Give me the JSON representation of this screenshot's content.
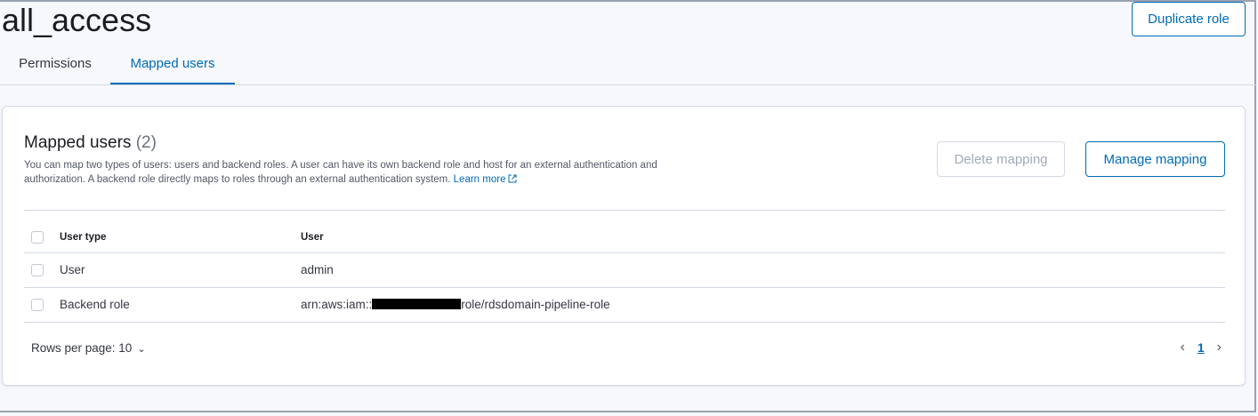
{
  "page": {
    "role_name": "all_access",
    "duplicate_label": "Duplicate role"
  },
  "tabs": [
    {
      "label": "Permissions",
      "active": false
    },
    {
      "label": "Mapped users",
      "active": true
    }
  ],
  "panel": {
    "title": "Mapped users",
    "count": "(2)",
    "description": "You can map two types of users: users and backend roles. A user can have its own backend role and host for an external authentication and authorization. A backend role directly maps to roles through an external authentication system.",
    "learn_more": "Learn more",
    "delete_label": "Delete mapping",
    "manage_label": "Manage mapping"
  },
  "table": {
    "headers": {
      "type": "User type",
      "user": "User"
    },
    "rows": [
      {
        "type": "User",
        "user_prefix": "admin",
        "user_suffix": ""
      },
      {
        "type": "Backend role",
        "user_prefix": "arn:aws:iam::",
        "user_suffix": "role/rdsdomain-pipeline-role"
      }
    ]
  },
  "pagination": {
    "rows_per_page": "Rows per page: 10",
    "current_page": "1"
  },
  "colors": {
    "accent": "#006bb8",
    "border": "#d3dae6",
    "disabled_text": "#a2abba"
  }
}
